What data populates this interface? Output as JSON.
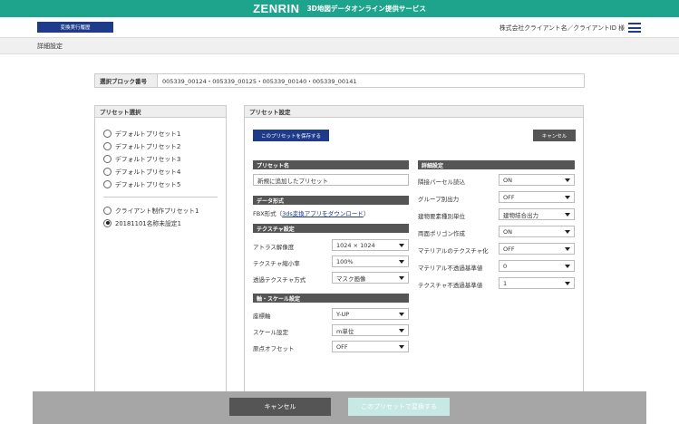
{
  "topbar": {
    "brand": "ZENRIN",
    "subtitle": "3D地図データオンライン提供サービス"
  },
  "header": {
    "history_button": "変換実行履歴",
    "client_name": "株式会社クライアント名／クライアントID 様"
  },
  "subheader": {
    "title": "詳細設定"
  },
  "block": {
    "label": "選択ブロック番号",
    "value": "005339_00124・005339_00125・005339_00140・005339_00141"
  },
  "preset_panel": {
    "title": "プリセット選択",
    "default_presets": [
      "デフォルトプリセット1",
      "デフォルトプリセット2",
      "デフォルトプリセット3",
      "デフォルトプリセット4",
      "デフォルトプリセット5"
    ],
    "client_presets": [
      "クライアント制作プリセット1",
      "20181101名称未設定1"
    ],
    "selected": "20181101名称未設定1"
  },
  "settings": {
    "title": "プリセット設定",
    "save_button": "このプリセットを保存する",
    "cancel_button": "キャンセル",
    "preset_name": {
      "header": "プリセット名",
      "value": "新規に追加したプリセット"
    },
    "data_format": {
      "header": "データ形式",
      "prefix": "FBX形式（",
      "link": "3ds変換アプリをダウンロード",
      "suffix": "）"
    },
    "texture": {
      "header": "テクスチャ設定",
      "rows": [
        {
          "label": "アトラス解像度",
          "value": "1024 × 1024"
        },
        {
          "label": "テクスチャ縮小率",
          "value": "100%"
        },
        {
          "label": "透過テクスチャ方式",
          "value": "マスク画像"
        }
      ]
    },
    "axis": {
      "header": "軸・スケール設定",
      "rows": [
        {
          "label": "座標軸",
          "value": "Y-UP"
        },
        {
          "label": "スケール設定",
          "value": "m単位"
        },
        {
          "label": "原点オフセット",
          "value": "OFF"
        }
      ]
    },
    "detail": {
      "header": "詳細設定",
      "rows": [
        {
          "label": "隣接パーセル読込",
          "value": "ON"
        },
        {
          "label": "グループ別出力",
          "value": "OFF"
        },
        {
          "label": "建物要素種別単位",
          "value": "建物結合出力"
        },
        {
          "label": "両面ポリゴン作成",
          "value": "ON"
        },
        {
          "label": "マテリアルのテクスチャ化",
          "value": "OFF"
        },
        {
          "label": "マテリアル不透過基準値",
          "value": "0"
        },
        {
          "label": "テクスチャ不透過基準値",
          "value": "1"
        }
      ]
    }
  },
  "footer": {
    "cancel_button": "キャンセル",
    "apply_button": "このプリセットで変換する"
  },
  "colors": {
    "brand": "#1ea38d",
    "navy": "#1e3a8a",
    "dark_button": "#555555",
    "disabled_button": "#c6e9e4"
  }
}
